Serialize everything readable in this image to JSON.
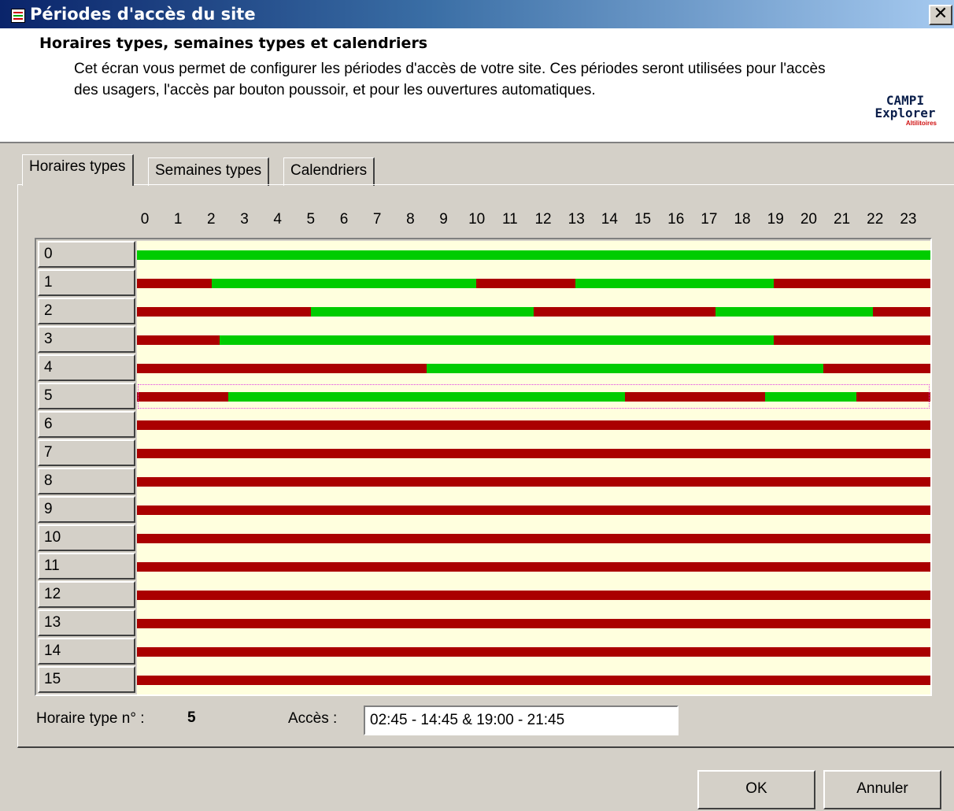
{
  "window": {
    "title": "Périodes d'accès du site",
    "close_label": "✕"
  },
  "header": {
    "title": "Horaires types, semaines types et calendriers",
    "description": "Cet écran vous permet de configurer les périodes d'accès de votre site. Ces périodes seront utilisées pour l'accès des usagers, l'accès par bouton poussoir, et pour les ouvertures automatiques.",
    "logo": {
      "line1": "CAMPI",
      "line2": "Explorer",
      "line3": "Altilitoires"
    }
  },
  "tabs": [
    {
      "label": "Horaires types",
      "active": true
    },
    {
      "label": "Semaines types",
      "active": false
    },
    {
      "label": "Calendriers",
      "active": false
    }
  ],
  "hours": [
    "0",
    "1",
    "2",
    "3",
    "4",
    "5",
    "6",
    "7",
    "8",
    "9",
    "10",
    "11",
    "12",
    "13",
    "14",
    "15",
    "16",
    "17",
    "18",
    "19",
    "20",
    "21",
    "22",
    "23"
  ],
  "colors": {
    "allowed": "#00cc00",
    "denied": "#aa0000",
    "track": "#ffffde"
  },
  "schedules": [
    {
      "id": "0",
      "allowed": [
        [
          "00:00",
          "24:00"
        ]
      ]
    },
    {
      "id": "1",
      "allowed": [
        [
          "02:15",
          "10:15"
        ],
        [
          "13:15",
          "19:15"
        ]
      ]
    },
    {
      "id": "2",
      "allowed": [
        [
          "05:15",
          "12:00"
        ],
        [
          "17:30",
          "22:15"
        ]
      ]
    },
    {
      "id": "3",
      "allowed": [
        [
          "02:30",
          "19:15"
        ]
      ]
    },
    {
      "id": "4",
      "allowed": [
        [
          "08:45",
          "20:45"
        ]
      ]
    },
    {
      "id": "5",
      "allowed": [
        [
          "02:45",
          "14:45"
        ],
        [
          "19:00",
          "21:45"
        ]
      ]
    },
    {
      "id": "6",
      "allowed": []
    },
    {
      "id": "7",
      "allowed": []
    },
    {
      "id": "8",
      "allowed": []
    },
    {
      "id": "9",
      "allowed": []
    },
    {
      "id": "10",
      "allowed": []
    },
    {
      "id": "11",
      "allowed": []
    },
    {
      "id": "12",
      "allowed": []
    },
    {
      "id": "13",
      "allowed": []
    },
    {
      "id": "14",
      "allowed": []
    },
    {
      "id": "15",
      "allowed": []
    }
  ],
  "selected_row": 5,
  "footer": {
    "schedule_label": "Horaire type n° :",
    "schedule_value": "5",
    "access_label": "Accès :",
    "access_value": "02:45 - 14:45 & 19:00 - 21:45"
  },
  "buttons": {
    "ok": "OK",
    "cancel": "Annuler"
  }
}
